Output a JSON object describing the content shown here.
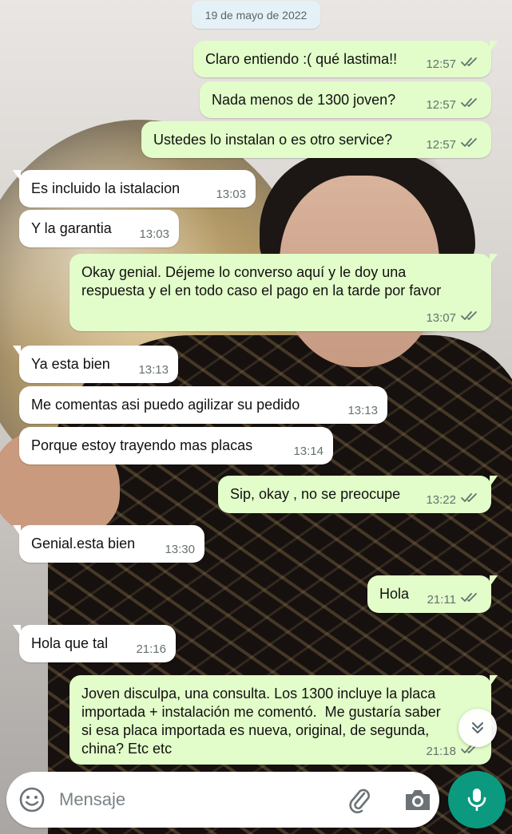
{
  "date_separator": "19 de mayo de 2022",
  "messages": [
    {
      "dir": "out",
      "text": "Claro entiendo :( qué lastima!!",
      "time": "12:57",
      "read": true
    },
    {
      "dir": "out",
      "text": "Nada menos de 1300 joven?",
      "time": "12:57",
      "read": true
    },
    {
      "dir": "out",
      "text": "Ustedes lo instalan o es otro service?",
      "time": "12:57",
      "read": true
    },
    {
      "dir": "in",
      "text": "Es incluido la istalacion",
      "time": "13:03"
    },
    {
      "dir": "in",
      "text": "Y la garantia",
      "time": "13:03"
    },
    {
      "dir": "out",
      "text": "Okay genial. Déjeme lo converso aquí y le doy una\nrespuesta y el en todo caso el pago en la tarde por favor",
      "time": "13:07",
      "read": true
    },
    {
      "dir": "in",
      "text": "Ya esta bien",
      "time": "13:13"
    },
    {
      "dir": "in",
      "text": "Me comentas asi puedo agilizar su pedido",
      "time": "13:13"
    },
    {
      "dir": "in",
      "text": "Porque estoy trayendo mas placas",
      "time": "13:14"
    },
    {
      "dir": "out",
      "text": "Sip, okay , no se preocupe",
      "time": "13:22",
      "read": true
    },
    {
      "dir": "in",
      "text": "Genial.esta bien",
      "time": "13:30"
    },
    {
      "dir": "out",
      "text": "Hola",
      "time": "21:11",
      "read": true
    },
    {
      "dir": "in",
      "text": "Hola que tal",
      "time": "21:16"
    },
    {
      "dir": "out",
      "text": "Joven disculpa, una consulta. Los 1300 incluye la placa\nimportada + instalación me comentó.  Me gustaría saber\nsi esa placa importada es nueva, original, de segunda,\nchina? Etc etc",
      "time": "21:18",
      "read": true
    }
  ],
  "composer": {
    "placeholder": "Mensaje",
    "emoji_icon": "emoji-icon",
    "attach_icon": "paperclip-icon",
    "camera_icon": "camera-icon",
    "send_icon": "microphone-icon"
  },
  "scroll_down_icon": "double-chevron-down-icon",
  "colors": {
    "outgoing_bubble": "#e2fdc9",
    "incoming_bubble": "#ffffff",
    "read_ticks": "#65726f",
    "mic_button": "#0b9a7f"
  }
}
